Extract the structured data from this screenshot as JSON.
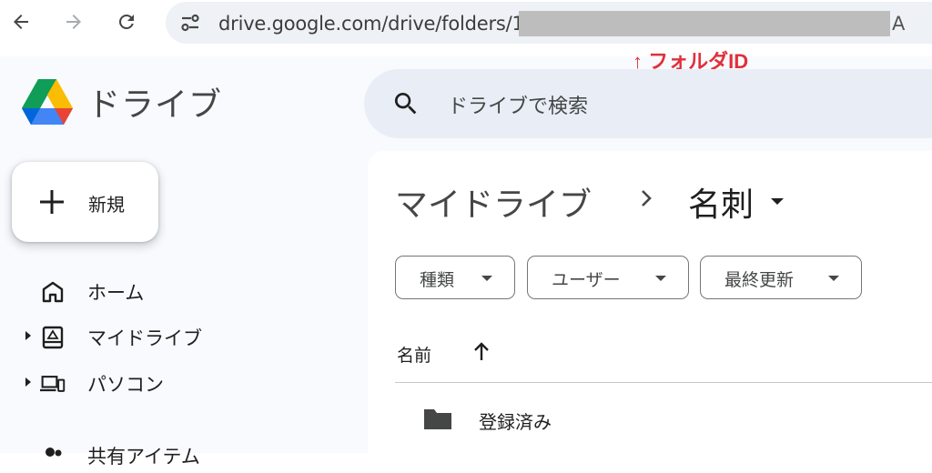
{
  "browser": {
    "url_prefix": "drive.google.com/drive/folders/1",
    "url_suffix": "A",
    "annotation": "↑ フォルダID",
    "icons": [
      "back-arrow-icon",
      "forward-arrow-icon",
      "reload-icon",
      "site-settings-icon"
    ]
  },
  "app": {
    "name": "ドライブ",
    "search_placeholder": "ドライブで検索",
    "new_button_label": "新規"
  },
  "sidebar": {
    "items": [
      {
        "label": "ホーム",
        "icon": "home-icon",
        "expandable": false
      },
      {
        "label": "マイドライブ",
        "icon": "my-drive-icon",
        "expandable": true
      },
      {
        "label": "パソコン",
        "icon": "computers-icon",
        "expandable": true
      },
      {
        "label": "共有アイテム",
        "icon": "shared-icon",
        "expandable": false
      }
    ]
  },
  "breadcrumb": {
    "root": "マイドライブ",
    "current": "名刺"
  },
  "filters": [
    {
      "label": "種類"
    },
    {
      "label": "ユーザー"
    },
    {
      "label": "最終更新"
    }
  ],
  "list": {
    "column_name": "名前",
    "sort": "ascending",
    "rows": [
      {
        "name": "登録済み",
        "type": "folder"
      }
    ]
  },
  "colors": {
    "annotation": "#e0303a",
    "search_bg": "#e9eef6",
    "app_bg": "#f8fafd",
    "urlbar_bg": "#eef1f6"
  }
}
